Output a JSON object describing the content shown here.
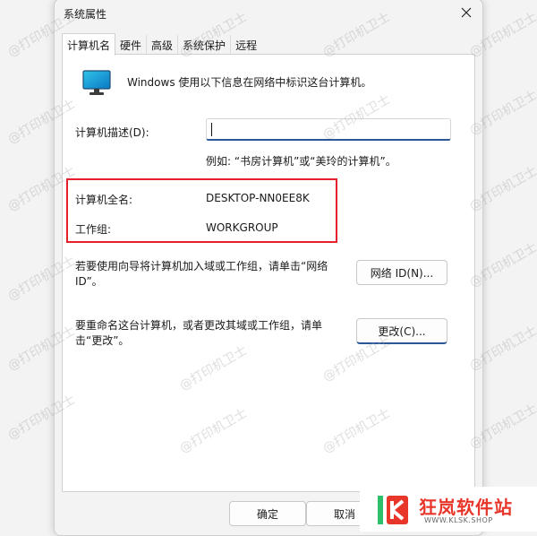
{
  "window": {
    "title": "系统属性"
  },
  "tabs": [
    {
      "label": "计算机名"
    },
    {
      "label": "硬件"
    },
    {
      "label": "高级"
    },
    {
      "label": "系统保护"
    },
    {
      "label": "远程"
    }
  ],
  "computer_name_tab": {
    "intro": "Windows 使用以下信息在网络中标识这台计算机。",
    "description_label": "计算机描述(D):",
    "description_value": "",
    "example_text": "例如: “书房计算机”或“美玲的计算机”。",
    "full_name_label": "计算机全名:",
    "full_name_value": "DESKTOP-NN0EE8K",
    "workgroup_label": "工作组:",
    "workgroup_value": "WORKGROUP",
    "network_wizard_text": "若要使用向导将计算机加入域或工作组，请单击“网络 ID”。",
    "network_id_button": "网络 ID(N)...",
    "rename_text": "要重命名这台计算机，或者更改其域或工作组，请单击“更改”。",
    "change_button": "更改(C)..."
  },
  "footer": {
    "ok_button": "确定",
    "cancel_button": "取消"
  },
  "watermark": {
    "text": "@打印机卫士"
  },
  "logo": {
    "name": "狂岚软件站",
    "url": "WWW.KLSK.SHOP"
  },
  "colors": {
    "highlight": "#e6202a",
    "accent": "#2b5797",
    "logo_red": "#e8362a"
  },
  "icons": {
    "computer": "monitor-icon",
    "close": "close-icon"
  }
}
